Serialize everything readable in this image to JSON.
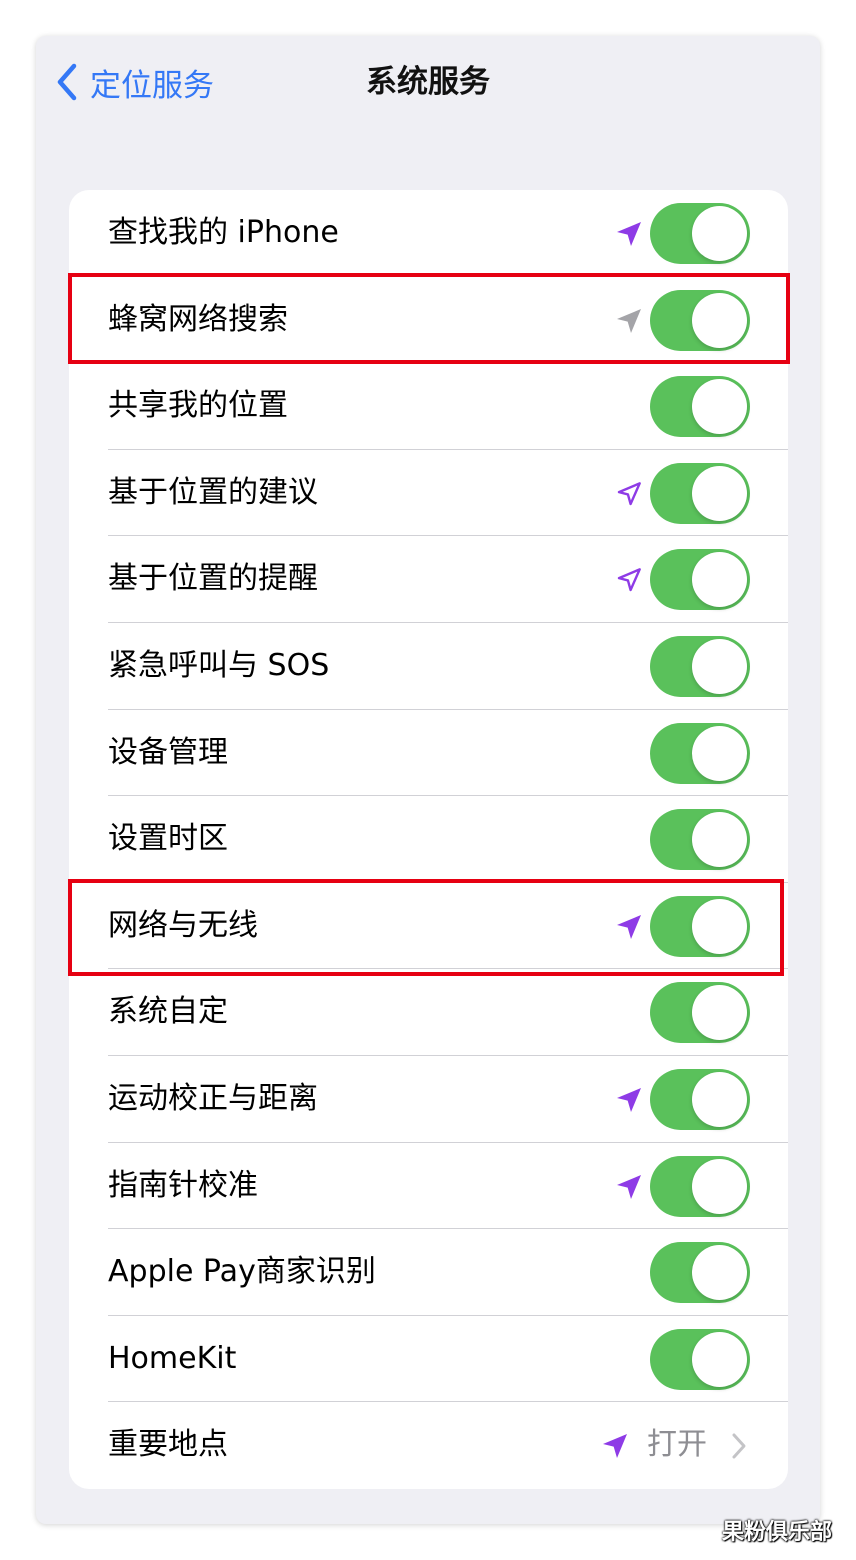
{
  "nav": {
    "back_label": "定位服务",
    "title": "系统服务"
  },
  "colors": {
    "accent": "#3478f6",
    "toggle_on": "#5ac15b",
    "location_active": "#8e3be6",
    "location_recent": "#a4a4a8",
    "highlight": "#e60012"
  },
  "rows": [
    {
      "label": "查找我的 iPhone",
      "toggle": "on",
      "location_icon": "location-arrow-filled-purple"
    },
    {
      "label": "蜂窝网络搜索",
      "toggle": "on",
      "location_icon": "location-arrow-filled-gray",
      "highlighted": true
    },
    {
      "label": "共享我的位置",
      "toggle": "on"
    },
    {
      "label": "基于位置的建议",
      "toggle": "on",
      "location_icon": "location-arrow-outline-purple"
    },
    {
      "label": "基于位置的提醒",
      "toggle": "on",
      "location_icon": "location-arrow-outline-purple"
    },
    {
      "label": "紧急呼叫与 SOS",
      "toggle": "on"
    },
    {
      "label": "设备管理",
      "toggle": "on"
    },
    {
      "label": "设置时区",
      "toggle": "on"
    },
    {
      "label": "网络与无线",
      "toggle": "on",
      "location_icon": "location-arrow-filled-purple",
      "highlighted": true
    },
    {
      "label": "系统自定",
      "toggle": "on"
    },
    {
      "label": "运动校正与距离",
      "toggle": "on",
      "location_icon": "location-arrow-filled-purple"
    },
    {
      "label": "指南针校准",
      "toggle": "on",
      "location_icon": "location-arrow-filled-purple"
    },
    {
      "label": "Apple Pay商家识别",
      "toggle": "on"
    },
    {
      "label": "HomeKit",
      "toggle": "on"
    },
    {
      "label": "重要地点",
      "value": "打开",
      "location_icon": "location-arrow-filled-purple",
      "disclosure": "chevron-right-icon"
    }
  ],
  "watermark": "果粉俱乐部"
}
